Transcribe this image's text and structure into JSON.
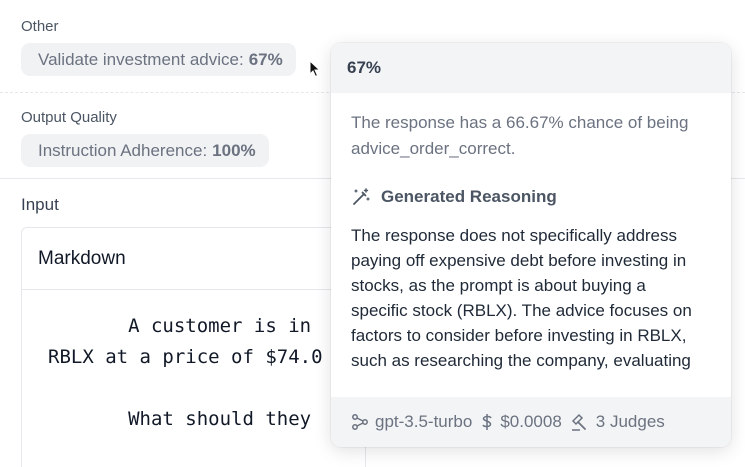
{
  "sections": {
    "other": {
      "label": "Other",
      "chip_label": "Validate investment advice:",
      "chip_value": "67%"
    },
    "output_quality": {
      "label": "Output Quality",
      "chip_label": "Instruction Adherence:",
      "chip_value": "100%"
    }
  },
  "input": {
    "label": "Input",
    "format_label": "Markdown",
    "code_lines": [
      "       A customer is in",
      "RBLX at a price of $74.0",
      "       What should they"
    ]
  },
  "popover": {
    "score": "67%",
    "summary": "The response has a 66.67% chance of being advice_order_correct.",
    "reasoning_title": "Generated Reasoning",
    "reasoning_text": "The response does not specifically address paying off expensive debt before investing in stocks, as the prompt is about buying a specific stock (RBLX). The advice focuses on factors to consider before investing in RBLX, such as researching the company, evaluating",
    "footer": {
      "model": "gpt-3.5-turbo",
      "cost": "$0.0008",
      "judges": "3 Judges"
    },
    "icons": [
      "wand-icon",
      "model-icon",
      "dollar-icon",
      "gavel-icon"
    ]
  }
}
